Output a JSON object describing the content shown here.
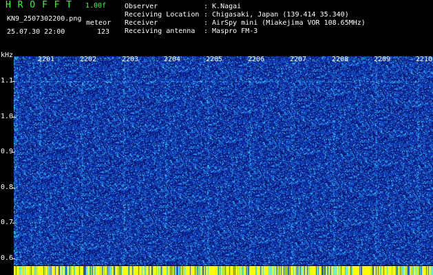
{
  "header": {
    "software": "H R O F F T",
    "version": "1.00f",
    "filename": "KN9_2507302200.png",
    "mode": "meteor",
    "datetime": "25.07.30 22:00",
    "count": "123",
    "observer_label": "Observer",
    "observer_value": ": K.Nagai",
    "location_label": "Receiving Location",
    "location_value": ": Chigasaki, Japan (139.414 35.340)",
    "receiver_label": "Receiver",
    "receiver_value": ": AirSpy mini (Miakejima VOR 108.65MHz)",
    "antenna_label": "Receiving antenna",
    "antenna_value": ": Maspro FM-3"
  },
  "chart_data": {
    "type": "heatmap",
    "ylabel": "kHz",
    "y_ticks": [
      "1.1",
      "1.0",
      "0.9",
      "0.8",
      "0.7",
      "0.6"
    ],
    "x_ticks": [
      "2201",
      "2202",
      "2203",
      "2204",
      "2205",
      "2206",
      "2207",
      "2208",
      "2209",
      "2210"
    ],
    "ylim": [
      0.58,
      1.17
    ],
    "colors": {
      "background": "#0b1f8c",
      "noise_hi": "#33d6ff",
      "noise_mid": "#1a52d9",
      "bottom_band": "#ffff00",
      "header_green": "#33ff33"
    }
  }
}
